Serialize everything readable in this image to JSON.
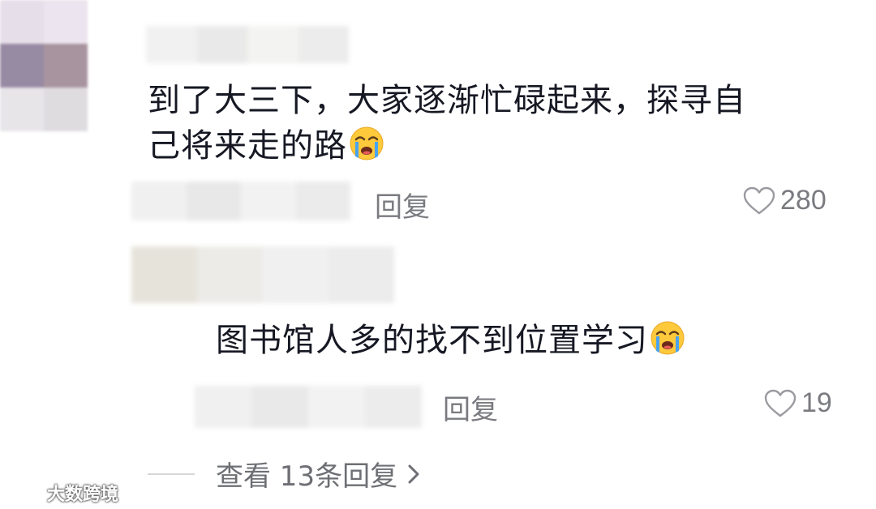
{
  "comments": [
    {
      "text": "到了大三下，大家逐渐忙碌起来，探寻自己将来走的路",
      "line1": "到了大三下，大家逐渐忙碌起来，探寻自",
      "line2": "己将来走的路",
      "emoji": "loudly-crying-face",
      "reply_label": "回复",
      "likes": "280"
    },
    {
      "text": "图书馆人多的找不到位置学习",
      "emoji": "loudly-crying-face",
      "reply_label": "回复",
      "likes": "19"
    }
  ],
  "view_more": {
    "label": "查看 13条回复"
  },
  "watermark": {
    "text": "大数跨境"
  },
  "colors": {
    "text": "#161823",
    "secondary": "#7a7b80",
    "divider": "#d6d6d8",
    "emoji_face": "#ffc93c",
    "emoji_tears": "#4aa3f0"
  }
}
